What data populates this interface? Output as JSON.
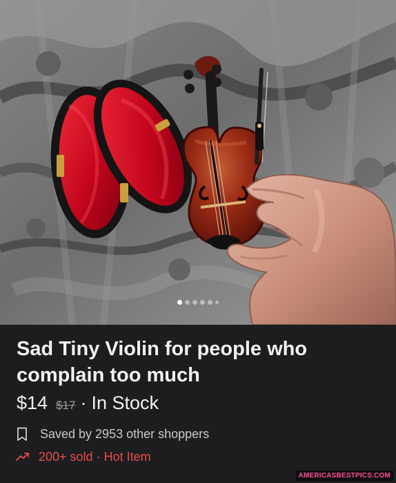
{
  "product": {
    "title": "Sad Tiny Violin for people who complain too much",
    "price": "$14",
    "original_price": "$17",
    "separator": "·",
    "stock_status": "In Stock"
  },
  "meta": {
    "saved_text": "Saved by 2953 other shoppers",
    "sold_text": "200+ sold",
    "hot_text": "Hot Item",
    "saved_icon": "bookmark-icon",
    "sold_icon": "trending-up-icon"
  },
  "gallery": {
    "image_count": 6,
    "active_index": 0,
    "image_icon": "product-photo"
  },
  "watermark": {
    "text": "AMERICASBESTPICS.COM"
  },
  "colors": {
    "background": "#1d1d20",
    "text": "#f2f2f2",
    "muted": "#c9c9c9",
    "hot": "#e84b4b",
    "watermark": "#ff4f9a"
  }
}
